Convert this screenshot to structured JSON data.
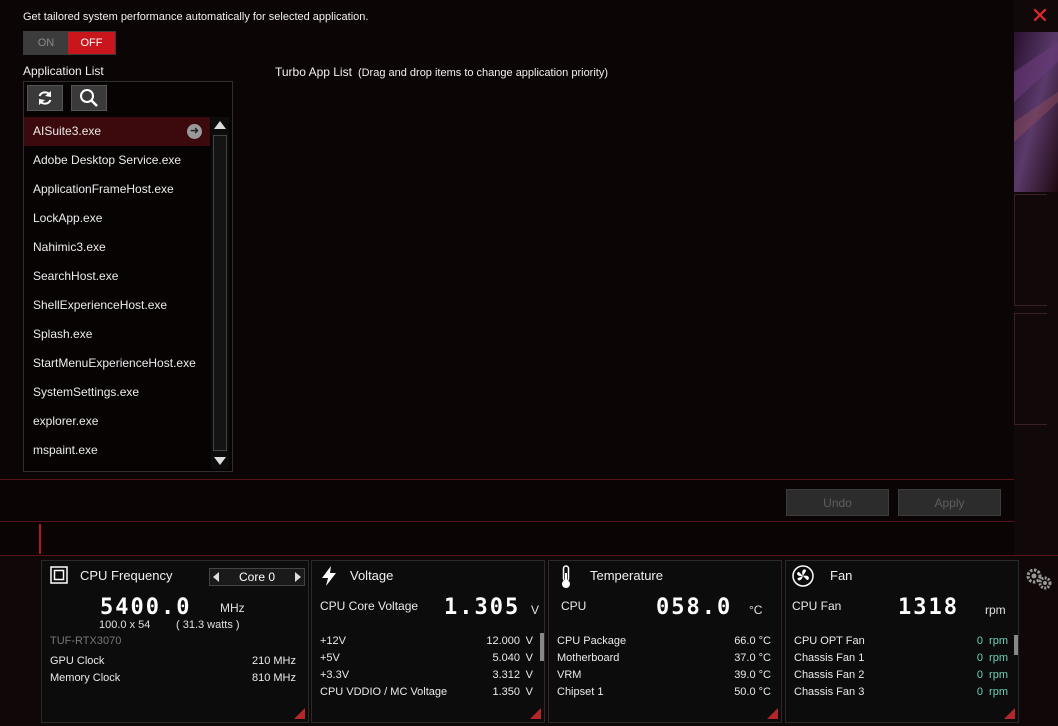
{
  "header": {
    "description": "Get tailored system performance automatically for selected application.",
    "toggle_on": "ON",
    "toggle_off": "OFF",
    "toggle_state": "OFF"
  },
  "app_list": {
    "label": "Application List",
    "items": [
      "AISuite3.exe",
      "Adobe Desktop Service.exe",
      "ApplicationFrameHost.exe",
      "LockApp.exe",
      "Nahimic3.exe",
      "SearchHost.exe",
      "ShellExperienceHost.exe",
      "Splash.exe",
      "StartMenuExperienceHost.exe",
      "SystemSettings.exe",
      "explorer.exe",
      "mspaint.exe"
    ],
    "selected_index": 0
  },
  "turbo": {
    "label": "Turbo App List",
    "hint": "(Drag and drop items to change application priority)"
  },
  "buttons": {
    "undo": "Undo",
    "apply": "Apply"
  },
  "monitor": {
    "cpu": {
      "title": "CPU Frequency",
      "core_select": "Core 0",
      "value": "5400.0",
      "unit": "MHz",
      "multiplier": "100.0  x  54",
      "watts": "( 31.3   watts )",
      "gpu_name": "TUF-RTX3070",
      "rows": [
        {
          "label": "GPU Clock",
          "value": "210 MHz"
        },
        {
          "label": "Memory Clock",
          "value": "810 MHz"
        }
      ]
    },
    "voltage": {
      "title": "Voltage",
      "main_label": "CPU Core Voltage",
      "value": "1.305",
      "unit": "V",
      "rows": [
        {
          "label": "+12V",
          "value": "12.000",
          "unit": "V"
        },
        {
          "label": "+5V",
          "value": "5.040",
          "unit": "V"
        },
        {
          "label": "+3.3V",
          "value": "3.312",
          "unit": "V"
        },
        {
          "label": "CPU VDDIO / MC Voltage",
          "value": "1.350",
          "unit": "V"
        }
      ]
    },
    "temperature": {
      "title": "Temperature",
      "main_label": "CPU",
      "value": "058.0",
      "unit": "°C",
      "rows": [
        {
          "label": "CPU Package",
          "value": "66.0 °C"
        },
        {
          "label": "Motherboard",
          "value": "37.0 °C"
        },
        {
          "label": "VRM",
          "value": "39.0 °C"
        },
        {
          "label": "Chipset 1",
          "value": "50.0 °C"
        }
      ]
    },
    "fan": {
      "title": "Fan",
      "main_label": "CPU Fan",
      "value": "1318",
      "unit": "rpm",
      "rows": [
        {
          "label": "CPU OPT Fan",
          "value": "0",
          "unit": "rpm"
        },
        {
          "label": "Chassis Fan 1",
          "value": "0",
          "unit": "rpm"
        },
        {
          "label": "Chassis Fan 2",
          "value": "0",
          "unit": "rpm"
        },
        {
          "label": "Chassis Fan 3",
          "value": "0",
          "unit": "rpm"
        }
      ]
    }
  },
  "colors": {
    "accent_red": "#c8161c",
    "selected_row": "#3c0a0c",
    "fan_value": "#6fd0b8"
  },
  "icons": {
    "refresh": "refresh-icon",
    "search": "search-icon",
    "close": "close-icon",
    "settings": "gear-icon"
  }
}
